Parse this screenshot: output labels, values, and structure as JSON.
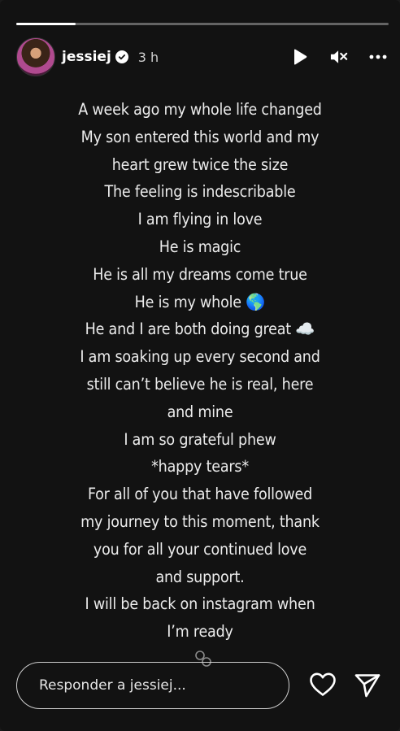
{
  "story": {
    "progress_fraction": 0.16,
    "user": {
      "username": "jessiej",
      "verified": true,
      "time_ago": "3 h"
    },
    "controls": {
      "play_icon": "play-icon",
      "mute_icon": "mute-icon",
      "more_icon": "more-options-icon"
    },
    "message_lines": [
      "A week ago my whole life changed",
      "My son entered this world and my",
      "heart grew twice the size",
      "The feeling is indescribable",
      "I am flying in love",
      "He is magic",
      "He is all my dreams come true",
      "He is my whole 🌎",
      "He and I are both doing great ☁️",
      "I am soaking up every second and",
      "still can’t believe he is real, here",
      "and mine",
      "I am so grateful phew",
      "*happy tears*",
      "For all of you that have followed",
      "my  journey to this moment, thank",
      "you for all your continued love",
      "and support.",
      "I will be back on instagram when",
      "I’m ready"
    ],
    "reply": {
      "placeholder": "Responder a jessiej..."
    },
    "actions": {
      "like_icon": "heart-icon",
      "share_icon": "send-icon"
    }
  }
}
